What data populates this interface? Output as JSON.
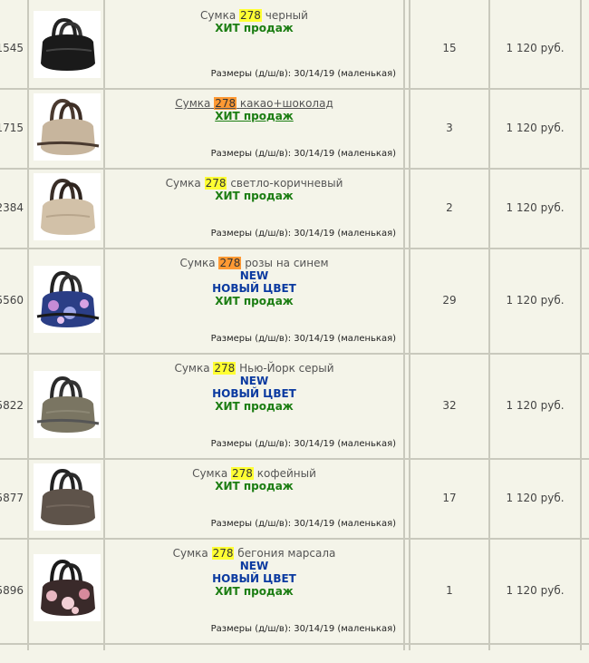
{
  "products": [
    {
      "id": "1545",
      "name_prefix": "Сумка",
      "highlight": "278",
      "name_suffix": "черный",
      "badge_new": "",
      "badge_new_color": "",
      "badge_hit": "ХИТ продаж",
      "size": "Размеры (д/ш/в): 30/14/19 (маленькая)",
      "qty": "15",
      "price": "1 120 руб.",
      "image": "bag-black"
    },
    {
      "id": "1715",
      "name_prefix": "Сумка",
      "highlight": "278",
      "name_suffix": "какао+шоколад",
      "badge_new": "",
      "badge_new_color": "",
      "badge_hit": "ХИТ продаж",
      "size": "Размеры (д/ш/в): 30/14/19 (маленькая)",
      "qty": "3",
      "price": "1 120 руб.",
      "image": "bag-cocoa"
    },
    {
      "id": "2384",
      "name_prefix": "Сумка",
      "highlight": "278",
      "name_suffix": "светло-коричневый",
      "badge_new": "",
      "badge_new_color": "",
      "badge_hit": "ХИТ продаж",
      "size": "Размеры (д/ш/в): 30/14/19 (маленькая)",
      "qty": "2",
      "price": "1 120 руб.",
      "image": "bag-lightbrown"
    },
    {
      "id": "5560",
      "name_prefix": "Сумка",
      "highlight": "278",
      "name_suffix": "розы на синем",
      "badge_new": "NEW",
      "badge_new_color": "НОВЫЙ ЦВЕТ",
      "badge_hit": "ХИТ продаж",
      "size": "Размеры (д/ш/в): 30/14/19 (маленькая)",
      "qty": "29",
      "price": "1 120 руб.",
      "image": "bag-roses-blue"
    },
    {
      "id": "5822",
      "name_prefix": "Сумка",
      "highlight": "278",
      "name_suffix": "Нью-Йорк серый",
      "badge_new": "NEW",
      "badge_new_color": "НОВЫЙ ЦВЕТ",
      "badge_hit": "ХИТ продаж",
      "size": "Размеры (д/ш/в): 30/14/19 (маленькая)",
      "qty": "32",
      "price": "1 120 руб.",
      "image": "bag-grey"
    },
    {
      "id": "5877",
      "name_prefix": "Сумка",
      "highlight": "278",
      "name_suffix": "кофейный",
      "badge_new": "",
      "badge_new_color": "",
      "badge_hit": "ХИТ продаж",
      "size": "Размеры (д/ш/в): 30/14/19 (маленькая)",
      "qty": "17",
      "price": "1 120 руб.",
      "image": "bag-coffee"
    },
    {
      "id": "5896",
      "name_prefix": "Сумка",
      "highlight": "278",
      "name_suffix": "бегония марсала",
      "badge_new": "NEW",
      "badge_new_color": "НОВЫЙ ЦВЕТ",
      "badge_hit": "ХИТ продаж",
      "size": "Размеры (д/ш/в): 30/14/19 (маленькая)",
      "qty": "1",
      "price": "1 120 руб.",
      "image": "bag-begonia"
    }
  ],
  "colors": {
    "highlight": "#ffff33",
    "highlight_active": "#ff9933",
    "hit": "#1b7d12",
    "new": "#0b3aa0",
    "bg": "#f4f4e9",
    "border": "#c9c9bd"
  }
}
